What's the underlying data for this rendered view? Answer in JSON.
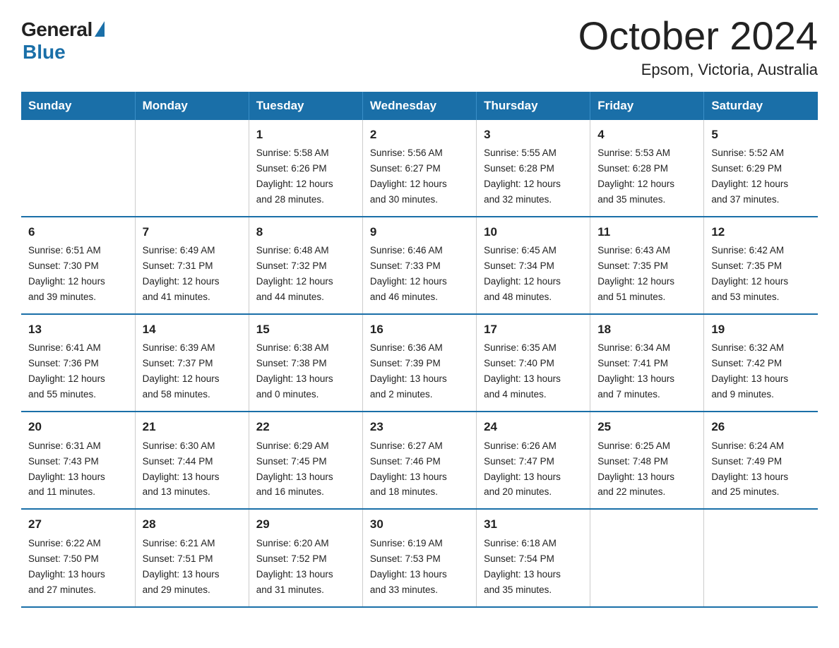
{
  "header": {
    "logo_general": "General",
    "logo_blue": "Blue",
    "title": "October 2024",
    "subtitle": "Epsom, Victoria, Australia"
  },
  "calendar": {
    "days_of_week": [
      "Sunday",
      "Monday",
      "Tuesday",
      "Wednesday",
      "Thursday",
      "Friday",
      "Saturday"
    ],
    "weeks": [
      [
        {
          "day": "",
          "info": ""
        },
        {
          "day": "",
          "info": ""
        },
        {
          "day": "1",
          "info": "Sunrise: 5:58 AM\nSunset: 6:26 PM\nDaylight: 12 hours\nand 28 minutes."
        },
        {
          "day": "2",
          "info": "Sunrise: 5:56 AM\nSunset: 6:27 PM\nDaylight: 12 hours\nand 30 minutes."
        },
        {
          "day": "3",
          "info": "Sunrise: 5:55 AM\nSunset: 6:28 PM\nDaylight: 12 hours\nand 32 minutes."
        },
        {
          "day": "4",
          "info": "Sunrise: 5:53 AM\nSunset: 6:28 PM\nDaylight: 12 hours\nand 35 minutes."
        },
        {
          "day": "5",
          "info": "Sunrise: 5:52 AM\nSunset: 6:29 PM\nDaylight: 12 hours\nand 37 minutes."
        }
      ],
      [
        {
          "day": "6",
          "info": "Sunrise: 6:51 AM\nSunset: 7:30 PM\nDaylight: 12 hours\nand 39 minutes."
        },
        {
          "day": "7",
          "info": "Sunrise: 6:49 AM\nSunset: 7:31 PM\nDaylight: 12 hours\nand 41 minutes."
        },
        {
          "day": "8",
          "info": "Sunrise: 6:48 AM\nSunset: 7:32 PM\nDaylight: 12 hours\nand 44 minutes."
        },
        {
          "day": "9",
          "info": "Sunrise: 6:46 AM\nSunset: 7:33 PM\nDaylight: 12 hours\nand 46 minutes."
        },
        {
          "day": "10",
          "info": "Sunrise: 6:45 AM\nSunset: 7:34 PM\nDaylight: 12 hours\nand 48 minutes."
        },
        {
          "day": "11",
          "info": "Sunrise: 6:43 AM\nSunset: 7:35 PM\nDaylight: 12 hours\nand 51 minutes."
        },
        {
          "day": "12",
          "info": "Sunrise: 6:42 AM\nSunset: 7:35 PM\nDaylight: 12 hours\nand 53 minutes."
        }
      ],
      [
        {
          "day": "13",
          "info": "Sunrise: 6:41 AM\nSunset: 7:36 PM\nDaylight: 12 hours\nand 55 minutes."
        },
        {
          "day": "14",
          "info": "Sunrise: 6:39 AM\nSunset: 7:37 PM\nDaylight: 12 hours\nand 58 minutes."
        },
        {
          "day": "15",
          "info": "Sunrise: 6:38 AM\nSunset: 7:38 PM\nDaylight: 13 hours\nand 0 minutes."
        },
        {
          "day": "16",
          "info": "Sunrise: 6:36 AM\nSunset: 7:39 PM\nDaylight: 13 hours\nand 2 minutes."
        },
        {
          "day": "17",
          "info": "Sunrise: 6:35 AM\nSunset: 7:40 PM\nDaylight: 13 hours\nand 4 minutes."
        },
        {
          "day": "18",
          "info": "Sunrise: 6:34 AM\nSunset: 7:41 PM\nDaylight: 13 hours\nand 7 minutes."
        },
        {
          "day": "19",
          "info": "Sunrise: 6:32 AM\nSunset: 7:42 PM\nDaylight: 13 hours\nand 9 minutes."
        }
      ],
      [
        {
          "day": "20",
          "info": "Sunrise: 6:31 AM\nSunset: 7:43 PM\nDaylight: 13 hours\nand 11 minutes."
        },
        {
          "day": "21",
          "info": "Sunrise: 6:30 AM\nSunset: 7:44 PM\nDaylight: 13 hours\nand 13 minutes."
        },
        {
          "day": "22",
          "info": "Sunrise: 6:29 AM\nSunset: 7:45 PM\nDaylight: 13 hours\nand 16 minutes."
        },
        {
          "day": "23",
          "info": "Sunrise: 6:27 AM\nSunset: 7:46 PM\nDaylight: 13 hours\nand 18 minutes."
        },
        {
          "day": "24",
          "info": "Sunrise: 6:26 AM\nSunset: 7:47 PM\nDaylight: 13 hours\nand 20 minutes."
        },
        {
          "day": "25",
          "info": "Sunrise: 6:25 AM\nSunset: 7:48 PM\nDaylight: 13 hours\nand 22 minutes."
        },
        {
          "day": "26",
          "info": "Sunrise: 6:24 AM\nSunset: 7:49 PM\nDaylight: 13 hours\nand 25 minutes."
        }
      ],
      [
        {
          "day": "27",
          "info": "Sunrise: 6:22 AM\nSunset: 7:50 PM\nDaylight: 13 hours\nand 27 minutes."
        },
        {
          "day": "28",
          "info": "Sunrise: 6:21 AM\nSunset: 7:51 PM\nDaylight: 13 hours\nand 29 minutes."
        },
        {
          "day": "29",
          "info": "Sunrise: 6:20 AM\nSunset: 7:52 PM\nDaylight: 13 hours\nand 31 minutes."
        },
        {
          "day": "30",
          "info": "Sunrise: 6:19 AM\nSunset: 7:53 PM\nDaylight: 13 hours\nand 33 minutes."
        },
        {
          "day": "31",
          "info": "Sunrise: 6:18 AM\nSunset: 7:54 PM\nDaylight: 13 hours\nand 35 minutes."
        },
        {
          "day": "",
          "info": ""
        },
        {
          "day": "",
          "info": ""
        }
      ]
    ]
  }
}
